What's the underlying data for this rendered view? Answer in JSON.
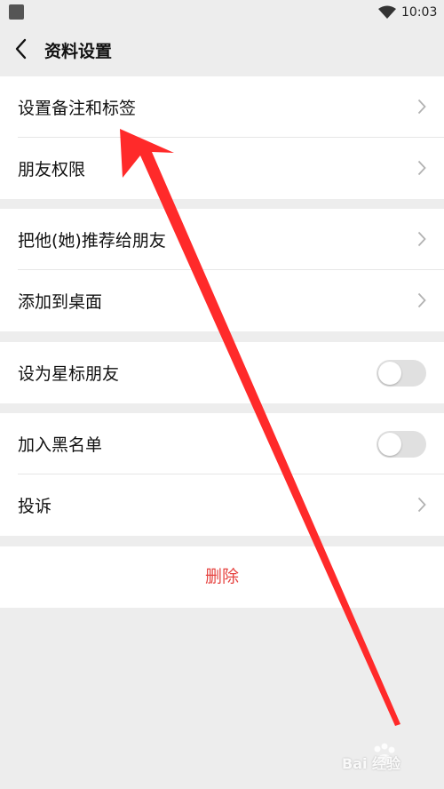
{
  "status_bar": {
    "time": "10:03"
  },
  "nav": {
    "title": "资料设置"
  },
  "groups": [
    {
      "rows": [
        {
          "label": "设置备注和标签",
          "control": "chevron"
        },
        {
          "label": "朋友权限",
          "control": "chevron"
        }
      ]
    },
    {
      "rows": [
        {
          "label": "把他(她)推荐给朋友",
          "control": "chevron"
        },
        {
          "label": "添加到桌面",
          "control": "chevron"
        }
      ]
    },
    {
      "rows": [
        {
          "label": "设为星标朋友",
          "control": "toggle",
          "on": false
        }
      ]
    },
    {
      "rows": [
        {
          "label": "加入黑名单",
          "control": "toggle",
          "on": false
        },
        {
          "label": "投诉",
          "control": "chevron"
        }
      ]
    }
  ],
  "delete": {
    "label": "删除"
  },
  "colors": {
    "accent_red": "#e64340",
    "overlay_arrow": "#ff2a2a"
  },
  "watermark": {
    "text": "Bai 经验"
  }
}
